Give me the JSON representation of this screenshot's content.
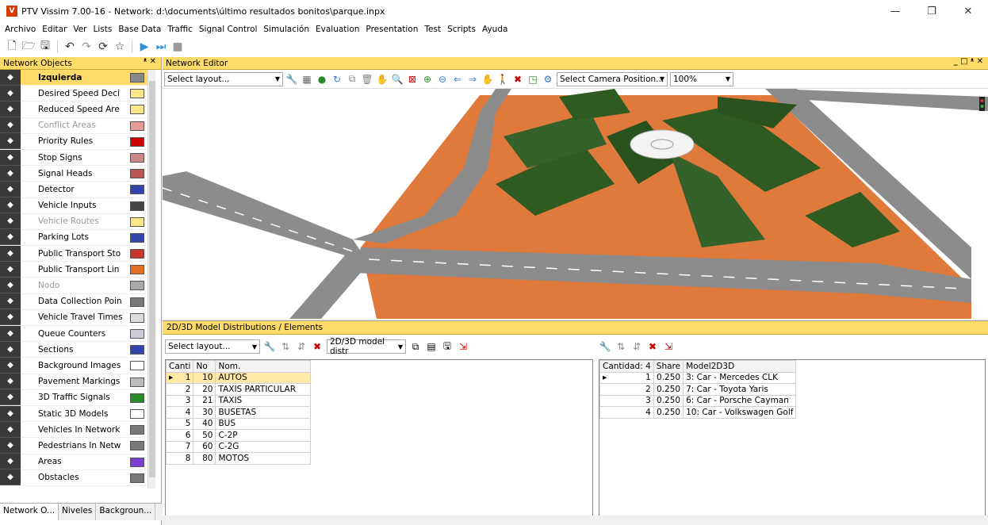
{
  "window": {
    "title": "PTV Vissim 7.00-16 - Network: d:\\documents\\último resultados bonitos\\parque.inpx",
    "minimize": "—",
    "restore": "❐",
    "close": "✕"
  },
  "menu": [
    "Archivo",
    "Editar",
    "Ver",
    "Lists",
    "Base Data",
    "Traffic",
    "Signal Control",
    "Simulación",
    "Evaluation",
    "Presentation",
    "Test",
    "Scripts",
    "Ayuda"
  ],
  "network_objects": {
    "title": "Network Objects",
    "pins": "ᵜ ✕",
    "items": [
      {
        "label": "Izquierda",
        "icon": "road-icon",
        "selected": true
      },
      {
        "label": "Desired Speed Deci",
        "icon": "speed-50-icon"
      },
      {
        "label": "Reduced Speed Are",
        "icon": "warning-icon"
      },
      {
        "label": "Conflict Areas",
        "icon": "conflict-icon",
        "dim": true
      },
      {
        "label": "Priority Rules",
        "icon": "yield-icon"
      },
      {
        "label": "Stop Signs",
        "icon": "stop-icon"
      },
      {
        "label": "Signal Heads",
        "icon": "traffic-light-icon"
      },
      {
        "label": "Detector",
        "icon": "detector-icon"
      },
      {
        "label": "Vehicle Inputs",
        "icon": "vehicle-input-icon"
      },
      {
        "label": "Vehicle Routes",
        "icon": "route-icon",
        "dim": true
      },
      {
        "label": "Parking Lots",
        "icon": "parking-icon"
      },
      {
        "label": "Public Transport Sto",
        "icon": "pt-stop-icon"
      },
      {
        "label": "Public Transport Lin",
        "icon": "pt-line-icon"
      },
      {
        "label": "Nodo",
        "icon": "node-icon",
        "dim": true
      },
      {
        "label": "Data Collection Poin",
        "icon": "data-point-icon"
      },
      {
        "label": "Vehicle Travel Times",
        "icon": "stopwatch-icon"
      },
      {
        "label": "Queue Counters",
        "icon": "queue-icon"
      },
      {
        "label": "Sections",
        "icon": "section-icon"
      },
      {
        "label": "Background Images",
        "icon": "image-icon"
      },
      {
        "label": "Pavement Markings",
        "icon": "marking-icon"
      },
      {
        "label": "3D Traffic Signals",
        "icon": "3d-signal-icon"
      },
      {
        "label": "Static 3D Models",
        "icon": "model-icon"
      },
      {
        "label": "Vehicles In Network",
        "icon": "vehicle-icon"
      },
      {
        "label": "Pedestrians In Netw",
        "icon": "pedestrian-icon"
      },
      {
        "label": "Areas",
        "icon": "area-icon"
      },
      {
        "label": "Obstacles",
        "icon": "obstacle-icon"
      }
    ],
    "tabs": [
      "Network O...",
      "Niveles",
      "Backgroun..."
    ]
  },
  "editor": {
    "title": "Network Editor",
    "layout_placeholder": "Select layout...",
    "camera": "Select Camera Position...",
    "zoom": "100%",
    "win_controls": "_ □ ᵜ ✕"
  },
  "distributions": {
    "title": "2D/3D Model Distributions / Elements",
    "layout": "Select layout...",
    "model_select": "2D/3D model distr",
    "left_headers": [
      "Canti",
      "No",
      "Nom."
    ],
    "left_rows": [
      {
        "marker": "▸",
        "cnt": "1",
        "no": "10",
        "name": "AUTOS"
      },
      {
        "marker": "",
        "cnt": "2",
        "no": "20",
        "name": "TAXIS PARTICULAR"
      },
      {
        "marker": "",
        "cnt": "3",
        "no": "21",
        "name": "TAXIS"
      },
      {
        "marker": "",
        "cnt": "4",
        "no": "30",
        "name": "BUSETAS"
      },
      {
        "marker": "",
        "cnt": "5",
        "no": "40",
        "name": "BUS"
      },
      {
        "marker": "",
        "cnt": "6",
        "no": "50",
        "name": "C-2P"
      },
      {
        "marker": "",
        "cnt": "7",
        "no": "60",
        "name": "C-2G"
      },
      {
        "marker": "",
        "cnt": "8",
        "no": "80",
        "name": "MOTOS"
      }
    ],
    "right_headers": [
      "Cantidad: 4",
      "Share",
      "Model2D3D"
    ],
    "right_rows": [
      {
        "marker": "▸",
        "cnt": "1",
        "share": "0.250",
        "model": "3: Car - Mercedes CLK"
      },
      {
        "marker": "",
        "cnt": "2",
        "share": "0.250",
        "model": "7: Car - Toyota Yaris"
      },
      {
        "marker": "",
        "cnt": "3",
        "share": "0.250",
        "model": "6: Car - Porsche Cayman"
      },
      {
        "marker": "",
        "cnt": "4",
        "share": "0.250",
        "model": "10: Car - Volkswagen Golf"
      }
    ]
  },
  "colors": {
    "panel_header": "#ffdc6a",
    "selection": "#ffdc6a",
    "plaza": "#e07a3c",
    "road": "#8c8c8c",
    "tree": "#2f5a22"
  }
}
